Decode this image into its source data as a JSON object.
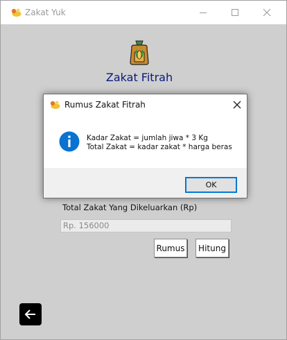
{
  "window": {
    "title": "Zakat Yuk",
    "controls": {
      "minimize": "minimize",
      "maximize": "maximize",
      "close": "close"
    }
  },
  "main": {
    "heading": "Zakat Fitrah",
    "total_label": "Total Zakat Yang Dikeluarkan (Rp)",
    "total_value": "Rp. 156000",
    "rumus_button": "Rumus",
    "hitung_button": "Hitung",
    "back_icon": "arrow-left-icon"
  },
  "dialog": {
    "title": "Rumus Zakat Fitrah",
    "line1": "Kadar Zakat = jumlah jiwa * 3 Kg",
    "line2": "Total Zakat = kadar zakat * harga beras",
    "ok_button": "OK",
    "icon": "info-icon"
  },
  "colors": {
    "heading": "#0a1a7a",
    "background": "#cfcfcf",
    "info_icon": "#0a72d0",
    "ok_border": "#0078d7"
  }
}
